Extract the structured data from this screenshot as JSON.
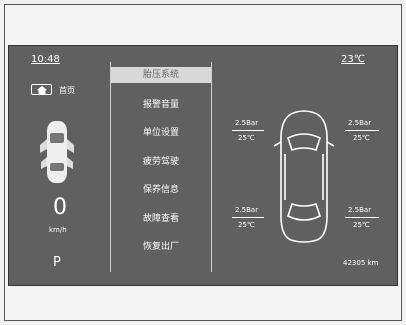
{
  "status": {
    "time": "10:48",
    "temperature": "23℃",
    "home_label": "首页",
    "odometer": "42305 km"
  },
  "left_panel": {
    "speed": "0",
    "speed_unit": "km/h",
    "gear": "P"
  },
  "menu": {
    "items": [
      {
        "label": "胎压系统",
        "selected": true
      },
      {
        "label": "报警音量",
        "selected": false
      },
      {
        "label": "单位设置",
        "selected": false
      },
      {
        "label": "疲劳驾驶",
        "selected": false
      },
      {
        "label": "保养信息",
        "selected": false
      },
      {
        "label": "故障查看",
        "selected": false
      },
      {
        "label": "恢复出厂",
        "selected": false
      }
    ]
  },
  "tires": {
    "front_left": {
      "pressure": "2.5Bar",
      "temp": "25℃"
    },
    "front_right": {
      "pressure": "2.5Bar",
      "temp": "25℃"
    },
    "rear_left": {
      "pressure": "2.5Bar",
      "temp": "25℃"
    },
    "rear_right": {
      "pressure": "2.5Bar",
      "temp": "25℃"
    }
  },
  "colors": {
    "screen_bg": "#606060",
    "text": "#ffffff",
    "selected_bg": "#d8d8d8"
  }
}
